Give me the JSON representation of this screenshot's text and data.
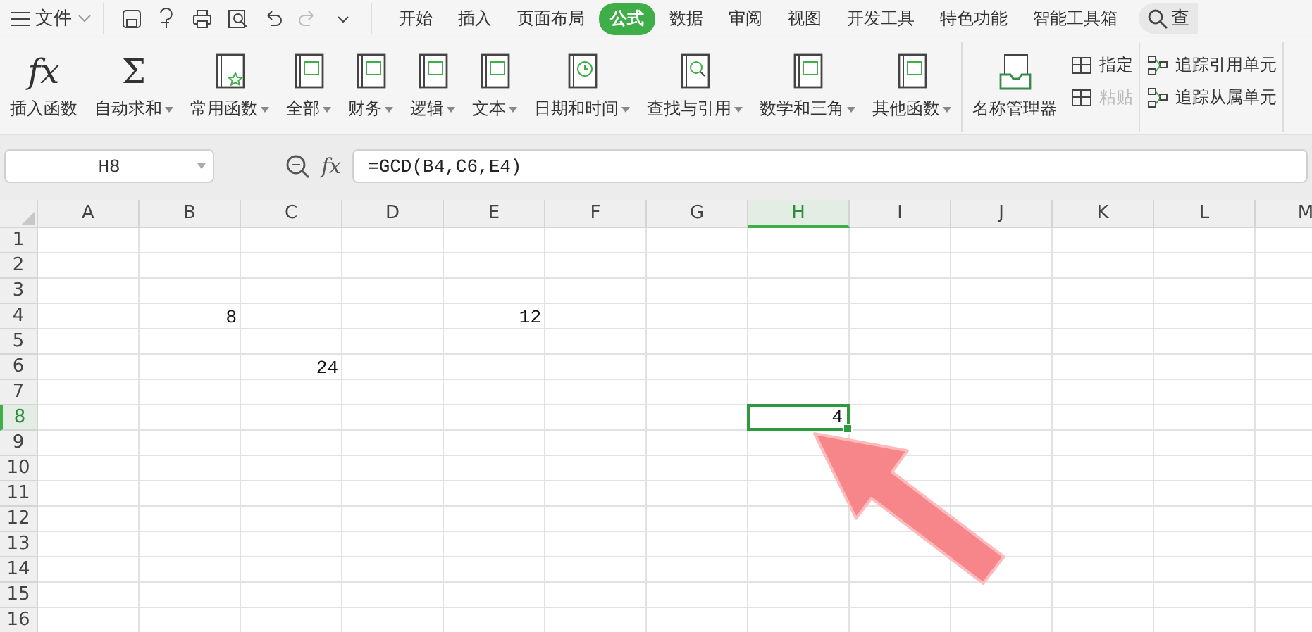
{
  "menu": {
    "label": "文件"
  },
  "tabs": [
    {
      "label": "开始",
      "selected": false
    },
    {
      "label": "插入",
      "selected": false
    },
    {
      "label": "页面布局",
      "selected": false
    },
    {
      "label": "公式",
      "selected": true
    },
    {
      "label": "数据",
      "selected": false
    },
    {
      "label": "审阅",
      "selected": false
    },
    {
      "label": "视图",
      "selected": false
    },
    {
      "label": "开发工具",
      "selected": false
    },
    {
      "label": "特色功能",
      "selected": false
    },
    {
      "label": "智能工具箱",
      "selected": false
    }
  ],
  "search": {
    "label": "查"
  },
  "ribbon": {
    "groups": [
      {
        "items": [
          {
            "kind": "glyph",
            "glyph": "fx",
            "label": "插入函数",
            "dropdown": false
          },
          {
            "kind": "glyph",
            "glyph": "Σ",
            "label": "自动求和",
            "dropdown": true
          },
          {
            "kind": "star",
            "label": "常用函数",
            "dropdown": true
          },
          {
            "kind": "book",
            "label": "全部",
            "dropdown": true
          },
          {
            "kind": "book",
            "label": "财务",
            "dropdown": true
          },
          {
            "kind": "book",
            "label": "逻辑",
            "dropdown": true
          },
          {
            "kind": "book",
            "label": "文本",
            "dropdown": true
          },
          {
            "kind": "clock",
            "label": "日期和时间",
            "dropdown": true
          },
          {
            "kind": "search",
            "label": "查找与引用",
            "dropdown": true
          },
          {
            "kind": "book",
            "label": "数学和三角",
            "dropdown": true
          },
          {
            "kind": "book",
            "label": "其他函数",
            "dropdown": true
          }
        ]
      },
      {
        "items": [
          {
            "kind": "tray",
            "label": "名称管理器",
            "dropdown": false
          },
          {
            "kind": "small",
            "label": "指定",
            "disabled": false
          },
          {
            "kind": "small",
            "label": "粘贴",
            "disabled": true
          }
        ]
      },
      {
        "items": [
          {
            "kind": "small",
            "label": "追踪引用单元",
            "disabled": false
          },
          {
            "kind": "small",
            "label": "追踪从属单元",
            "disabled": false
          }
        ]
      }
    ]
  },
  "name_box": "H8",
  "formula_bar": {
    "glyph": "fx",
    "value": "=GCD(B4,C6,E4)"
  },
  "columns": [
    {
      "label": "A",
      "selected": false
    },
    {
      "label": "B",
      "selected": false
    },
    {
      "label": "C",
      "selected": false
    },
    {
      "label": "D",
      "selected": false
    },
    {
      "label": "E",
      "selected": false
    },
    {
      "label": "F",
      "selected": false
    },
    {
      "label": "G",
      "selected": false
    },
    {
      "label": "H",
      "selected": true
    },
    {
      "label": "I",
      "selected": false
    },
    {
      "label": "J",
      "selected": false
    },
    {
      "label": "K",
      "selected": false
    },
    {
      "label": "L",
      "selected": false
    },
    {
      "label": "M",
      "selected": false
    }
  ],
  "rows": [
    {
      "label": "1",
      "selected": false
    },
    {
      "label": "2",
      "selected": false
    },
    {
      "label": "3",
      "selected": false
    },
    {
      "label": "4",
      "selected": false,
      "cells": [
        null,
        "8",
        null,
        null,
        "12"
      ]
    },
    {
      "label": "5",
      "selected": false
    },
    {
      "label": "6",
      "selected": false,
      "cells": [
        null,
        null,
        "24"
      ]
    },
    {
      "label": "7",
      "selected": false
    },
    {
      "label": "8",
      "selected": true,
      "cells": [
        null,
        null,
        null,
        null,
        null,
        null,
        null,
        "4"
      ]
    },
    {
      "label": "9",
      "selected": false
    },
    {
      "label": "10",
      "selected": false
    },
    {
      "label": "11",
      "selected": false
    },
    {
      "label": "12",
      "selected": false
    },
    {
      "label": "13",
      "selected": false
    },
    {
      "label": "14",
      "selected": false
    },
    {
      "label": "15",
      "selected": false
    },
    {
      "label": "16",
      "selected": false
    }
  ]
}
